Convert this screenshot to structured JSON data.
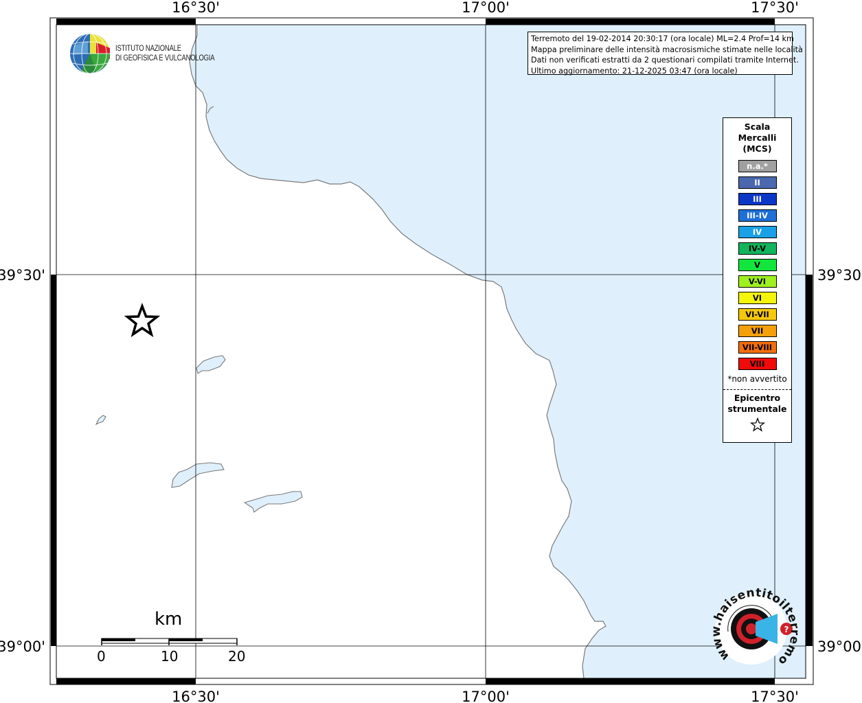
{
  "info_box": {
    "lines": [
      "Terremoto del 19-02-2014 20:30:17 (ora locale) ML=2.4 Prof=14 km",
      "Mappa preliminare delle intensità macrosismiche stimate nelle località",
      "Dati non verificati estratti da 2 questionari compilati tramite Internet.",
      "Ultimo aggiornamento: 21-12-2025 03:47 (ora locale)"
    ]
  },
  "institute": {
    "line1": "ISTITUTO NAZIONALE",
    "line2": "DI GEOFISICA E VULCANOLOGIA"
  },
  "axes": {
    "top": [
      "16°30'",
      "17°00'",
      "17°30'"
    ],
    "bottom": [
      "16°30'",
      "17°00'",
      "17°30'"
    ],
    "left": [
      "39°30'",
      "39°00'"
    ],
    "right": [
      "39°30'",
      "39°00'"
    ]
  },
  "legend": {
    "title_lines": [
      "Scala",
      "Mercalli",
      "(MCS)"
    ],
    "items": [
      {
        "label": "n.a.*",
        "color": "#a0a0a0",
        "text_color": "#ffffff"
      },
      {
        "label": "II",
        "color": "#4a67b0",
        "text_color": "#ffffff"
      },
      {
        "label": "III",
        "color": "#0a37c8",
        "text_color": "#ffffff"
      },
      {
        "label": "III-IV",
        "color": "#1e6fd6",
        "text_color": "#ffffff"
      },
      {
        "label": "IV",
        "color": "#1aa0e6",
        "text_color": "#ffffff"
      },
      {
        "label": "IV-V",
        "color": "#12b45c",
        "text_color": "#000000"
      },
      {
        "label": "V",
        "color": "#12e63c",
        "text_color": "#000000"
      },
      {
        "label": "V-VI",
        "color": "#9ef01e",
        "text_color": "#000000"
      },
      {
        "label": "VI",
        "color": "#f5f50a",
        "text_color": "#000000"
      },
      {
        "label": "VI-VII",
        "color": "#f5c80a",
        "text_color": "#000000"
      },
      {
        "label": "VII",
        "color": "#f5a00a",
        "text_color": "#000000"
      },
      {
        "label": "VII-VIII",
        "color": "#f56e0a",
        "text_color": "#000000"
      },
      {
        "label": "VIII",
        "color": "#f00a0a",
        "text_color": "#000000"
      }
    ],
    "note": "*non avvertito",
    "epicentre_lines": [
      "Epicentro",
      "strumentale"
    ],
    "epicentre_icon": "star-icon"
  },
  "scale_bar": {
    "unit": "km",
    "labels": [
      "0",
      "10",
      "20"
    ]
  },
  "badge": {
    "text": "www.haisentitoilterremoto.it",
    "icon": "target-icon"
  },
  "colors": {
    "sea": "#dff0fc",
    "coast": "#7a7a7a",
    "grid": "#000000",
    "frame": "#000000"
  }
}
